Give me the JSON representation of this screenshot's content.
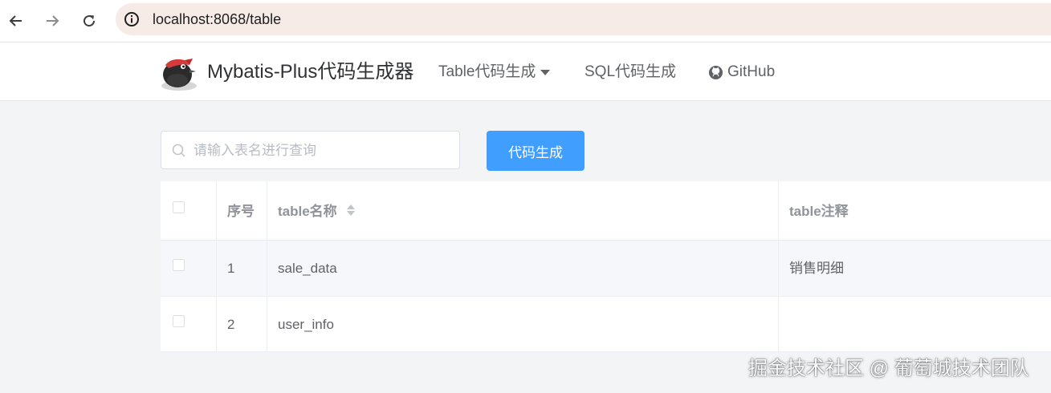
{
  "browser": {
    "url": "localhost:8068/table"
  },
  "header": {
    "brand": "Mybatis-Plus代码生成器",
    "menu": {
      "table_gen": "Table代码生成",
      "sql_gen": "SQL代码生成",
      "github": "GitHub"
    }
  },
  "toolbar": {
    "search_placeholder": "请输入表名进行查询",
    "search_value": "",
    "generate_label": "代码生成"
  },
  "table": {
    "columns": [
      "序号",
      "table名称",
      "table注释"
    ],
    "rows": [
      {
        "index": "1",
        "name": "sale_data",
        "comment": "销售明细"
      },
      {
        "index": "2",
        "name": "user_info",
        "comment": ""
      }
    ]
  },
  "watermark": "掘金技术社区 @ 葡萄城技术团队",
  "colors": {
    "primary": "#409eff",
    "background": "#f3f4f6",
    "address_bar": "#f6ebe6"
  }
}
